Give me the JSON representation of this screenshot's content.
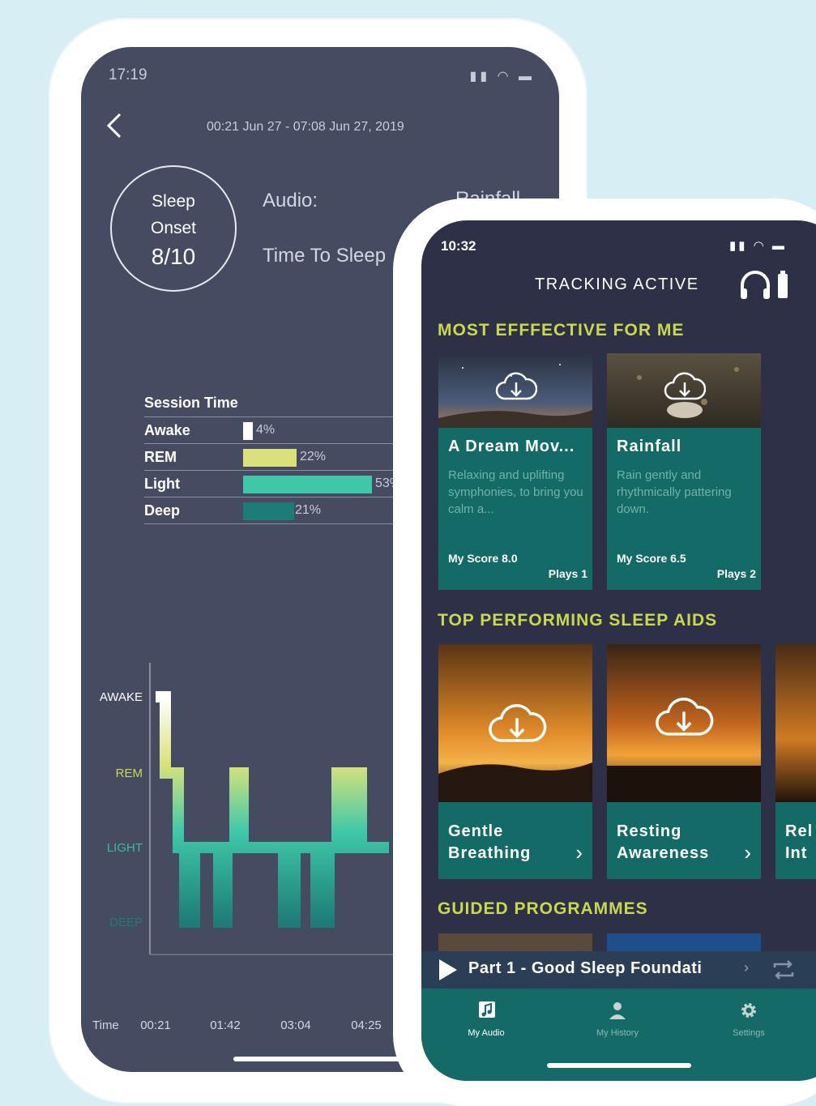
{
  "back_phone": {
    "status_time": "17:19",
    "date_range": "00:21 Jun 27 - 07:08 Jun 27, 2019",
    "sleep_onset": {
      "line1": "Sleep",
      "line2": "Onset",
      "score": "8/10"
    },
    "audio_label": "Audio:",
    "audio_value": "Rainfall",
    "time_to_sleep_label": "Time To Sleep",
    "session": {
      "header": "Session Time",
      "rows": [
        {
          "name": "Awake",
          "pct": "4%",
          "value": 4,
          "color": "#ffffff"
        },
        {
          "name": "REM",
          "pct": "22%",
          "value": 22,
          "color": "#d9e27a"
        },
        {
          "name": "Light",
          "pct": "53%",
          "value": 53,
          "color": "#3fc8a8"
        },
        {
          "name": "Deep",
          "pct": "21%",
          "value": 21,
          "color": "#1e7c78"
        }
      ]
    },
    "hypnogram": {
      "y_labels": [
        "AWAKE",
        "REM",
        "LIGHT",
        "DEEP"
      ],
      "x_axis_label": "Time",
      "x_ticks": [
        "00:21",
        "01:42",
        "03:04",
        "04:25"
      ]
    }
  },
  "front_phone": {
    "status_time": "10:32",
    "header_title": "TRACKING ACTIVE",
    "section_most_effective": "MOST EFFFECTIVE FOR ME",
    "effective_cards": [
      {
        "title": "A Dream Mov...",
        "desc": "Relaxing and uplifting symphonies, to bring you calm a...",
        "score": "My Score 8.0",
        "plays": "Plays 1"
      },
      {
        "title": "Rainfall",
        "desc": "Rain gently and rhythmically pattering down.",
        "score": "My Score 6.5",
        "plays": "Plays 2"
      }
    ],
    "section_top_performing": "TOP PERFORMING SLEEP AIDS",
    "top_cards": [
      {
        "title": "Gentle Breathing"
      },
      {
        "title": "Resting Awareness"
      },
      {
        "title": "Rel Int"
      }
    ],
    "section_guided": "GUIDED PROGRAMMES",
    "player": {
      "title": "Part 1 - Good Sleep Foundati"
    },
    "tabs": [
      {
        "label": "My Audio",
        "icon": "music-note-icon",
        "active": true
      },
      {
        "label": "My History",
        "icon": "person-icon",
        "active": false
      },
      {
        "label": "Settings",
        "icon": "gear-icon",
        "active": false
      }
    ]
  },
  "colors": {
    "background": "#d6eef4",
    "back_screen": "#454b60",
    "front_screen": "#2d3047",
    "teal": "#136a67",
    "accent_yellow": "#c9d84e"
  }
}
